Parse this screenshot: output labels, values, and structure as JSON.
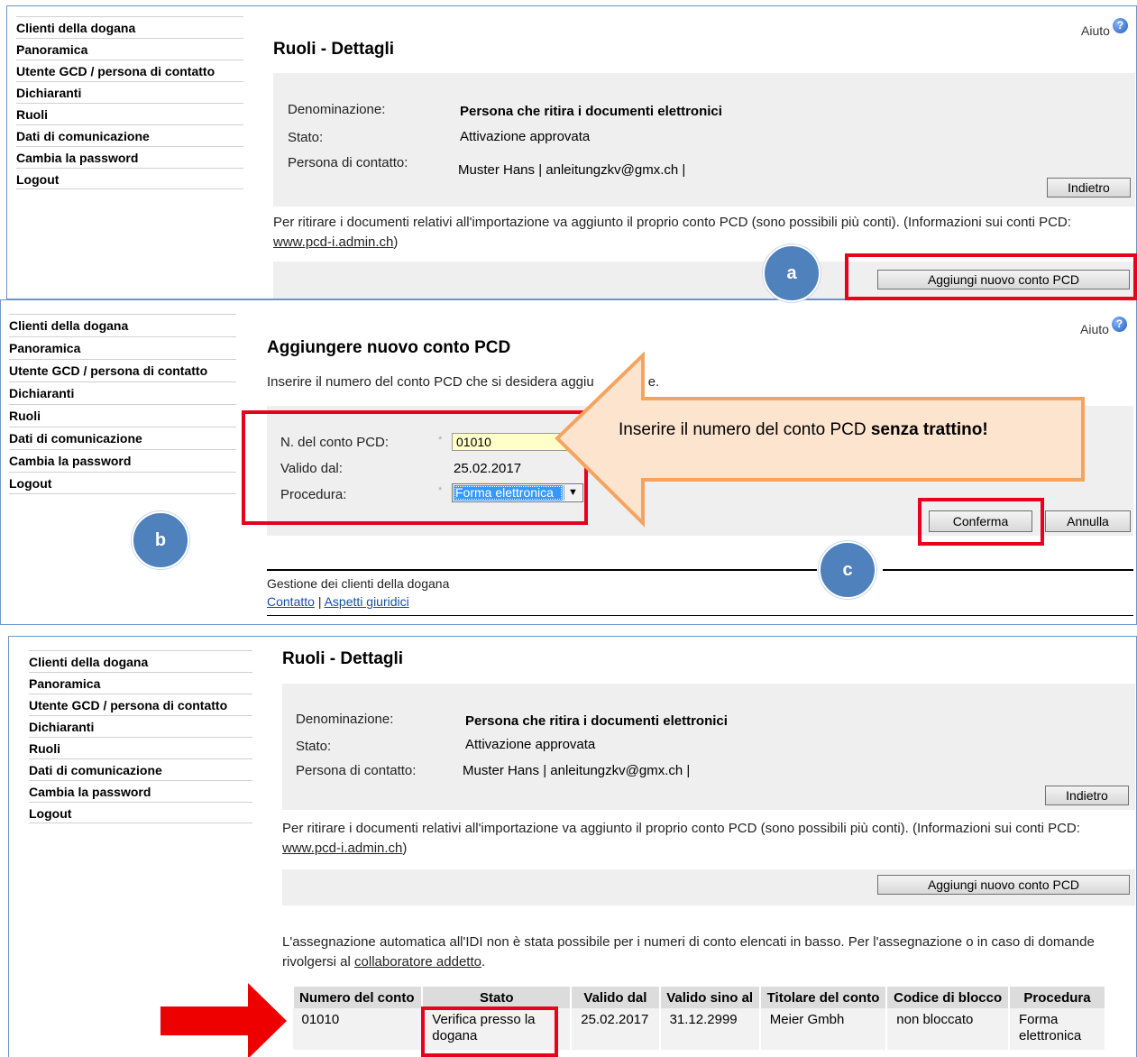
{
  "nav": {
    "items": [
      "Clienti della dogana",
      "Panoramica",
      "Utente GCD / persona di contatto",
      "Dichiaranti",
      "Ruoli",
      "Dati di comunicazione",
      "Cambia la password",
      "Logout"
    ]
  },
  "help_label": "Aiuto",
  "help_icon": "?",
  "details": {
    "title": "Ruoli - Dettagli",
    "label_name": "Denominazione:",
    "value_name": "Persona che ritira i documenti elettronici",
    "label_status": "Stato:",
    "value_status": "Attivazione approvata",
    "label_contact": "Persona di contatto:",
    "value_contact": "Muster Hans | anleitungzkv@gmx.ch |",
    "back_button": "Indietro",
    "info_text": "Per ritirare i documenti relativi all'importazione va aggiunto il proprio conto PCD (sono possibili più conti). (Informazioni sui conti PCD:",
    "info_link": "www.pcd-i.admin.ch",
    "info_close": ")",
    "add_button": "Aggiungi nuovo conto PCD"
  },
  "add_form": {
    "title": "Aggiungere nuovo conto PCD",
    "instruction_before": "Inserire il numero del conto PCD che si desidera aggiu",
    "instruction_after": "e.",
    "label_account": "N. del conto PCD:",
    "value_account": "01010",
    "label_valid": "Valido dal:",
    "value_valid": "25.02.2017",
    "label_procedure": "Procedura:",
    "value_procedure": "Forma elettronica",
    "required_mark": "*",
    "confirm_button": "Conferma",
    "cancel_button": "Annulla",
    "footer_title": "Gestione dei clienti della dogana",
    "footer_contact": "Contatto",
    "footer_sep": "|",
    "footer_legal": "Aspetti giuridici"
  },
  "callout": {
    "text_plain": "Inserire il numero del conto PCD ",
    "text_bold": "senza trattino!"
  },
  "markers": {
    "a": "a",
    "b": "b",
    "c": "c"
  },
  "result": {
    "note_text": "L'assegnazione automatica all'IDI non è stata possibile per i numeri di conto elencati in basso. Per l'assegnazione o in caso di domande rivolgersi al",
    "note_link": "collaboratore addetto",
    "note_end": ".",
    "columns": [
      "Numero del conto",
      "Stato",
      "Valido dal",
      "Valido sino al",
      "Titolare del conto",
      "Codice di blocco",
      "Procedura"
    ],
    "row": {
      "account": "01010",
      "status": "Verifica presso la dogana",
      "valid_from": "25.02.2017",
      "valid_to": "31.12.2999",
      "holder": "Meier Gmbh",
      "block_code": "non bloccato",
      "procedure": "Forma elettronica"
    }
  },
  "colors": {
    "highlight": "#e8001c",
    "marker": "#4f81bd",
    "callout_fill": "#fde4cf",
    "callout_border": "#f4a460"
  }
}
